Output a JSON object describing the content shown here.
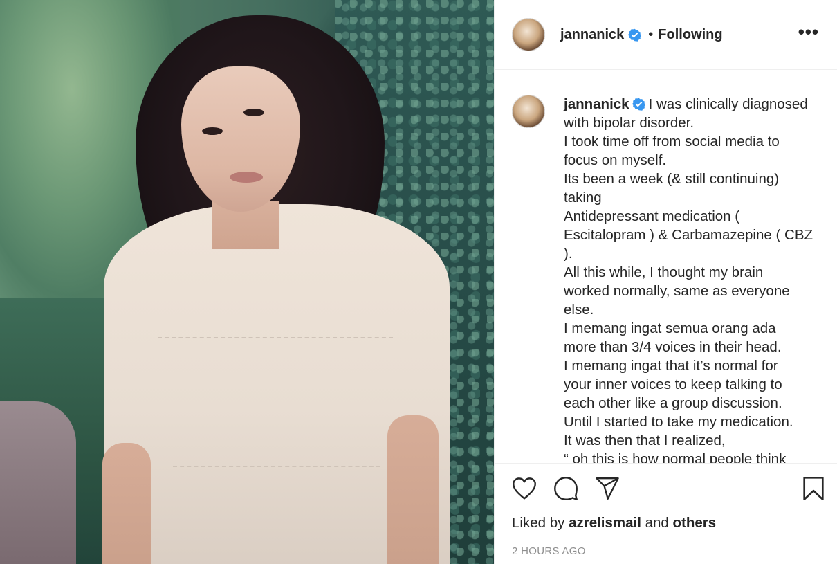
{
  "post": {
    "username": "jannanick",
    "separator": "•",
    "follow_state": "Following",
    "more_label": "•••",
    "caption_lines": [
      "I was clinically diagnosed",
      "with bipolar disorder.",
      "I took time off from social media to",
      "focus on myself.",
      "Its been a week (& still continuing)",
      "taking",
      "Antidepressant medication (",
      "Escitalopram ) & Carbamazepine ( CBZ",
      ").",
      "All this while, I thought my brain",
      "worked normally, same as everyone",
      "else.",
      "I memang ingat semua orang ada",
      "more than 3/4 voices in their head.",
      "I memang ingat that it’s normal for",
      "your inner voices to keep talking to",
      "each other like a group discussion.",
      "Until I started to take my medication.",
      "It was then that I realized,",
      "“ oh this is how normal people think"
    ],
    "liked_by_prefix": "Liked by",
    "liked_by_user": "azrelismail",
    "liked_by_and": "and",
    "liked_by_others": "others",
    "timestamp": "2 HOURS AGO"
  },
  "icons": {
    "verified": "verified-badge-icon",
    "like": "heart-icon",
    "comment": "comment-icon",
    "share": "paper-plane-icon",
    "save": "bookmark-icon",
    "more": "more-options-icon"
  },
  "colors": {
    "verified_blue": "#3897f0",
    "text": "#262626",
    "muted": "#8e8e8e",
    "divider": "#efefef"
  }
}
